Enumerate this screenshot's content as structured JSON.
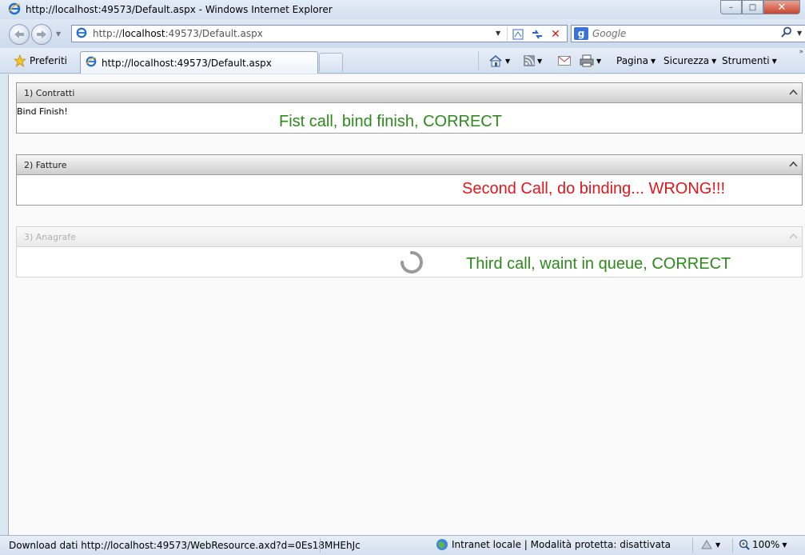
{
  "window": {
    "title": "http://localhost:49573/Default.aspx - Windows Internet Explorer",
    "minimize_glyph": "–",
    "maximize_glyph": "□",
    "close_glyph": "✕"
  },
  "navigation": {
    "address_host_prefix": "http://",
    "address_host": "localhost",
    "address_rest": ":49573/Default.aspx",
    "search_placeholder": "Google",
    "search_engine_letter": "g",
    "stop_glyph": "✕"
  },
  "favorites": {
    "label": "Preferiti"
  },
  "tab": {
    "label": "http://localhost:49573/Default.aspx"
  },
  "command_bar": {
    "page": "Pagina",
    "safety": "Sicurezza",
    "tools": "Strumenti"
  },
  "panels": [
    {
      "header": "1) Contratti",
      "body_text": "Bind Finish!",
      "annotation": "Fist call, bind finish, CORRECT"
    },
    {
      "header": "2) Fatture",
      "annotation": "Second Call, do binding... WRONG!!!"
    },
    {
      "header": "3) Anagrafe",
      "annotation": "Third call, waint in queue, CORRECT"
    }
  ],
  "statusbar": {
    "text": "Download dati http://localhost:49573/WebResource.axd?d=0Es18MHEhJc",
    "zone": "Intranet locale | Modalità protetta: disattivata",
    "zoom": "100%"
  },
  "colors": {
    "annotation_correct": "#2c8a1b",
    "annotation_wrong": "#e3161b",
    "panel_header": "#d9d9d9",
    "chrome": "#dbe6f3"
  },
  "icons": {
    "ie": "ie-logo-icon",
    "back": "back-arrow-icon",
    "forward": "forward-arrow-icon",
    "compat": "compatibility-view-icon",
    "refresh": "refresh-icon",
    "stop": "stop-icon",
    "search": "search-icon",
    "favorites": "star-icon",
    "home": "home-icon",
    "feeds": "feeds-icon",
    "mail": "mail-icon",
    "print": "print-icon",
    "loading": "loading-spinner-icon",
    "zone": "globe-icon",
    "zoom": "zoom-icon"
  }
}
